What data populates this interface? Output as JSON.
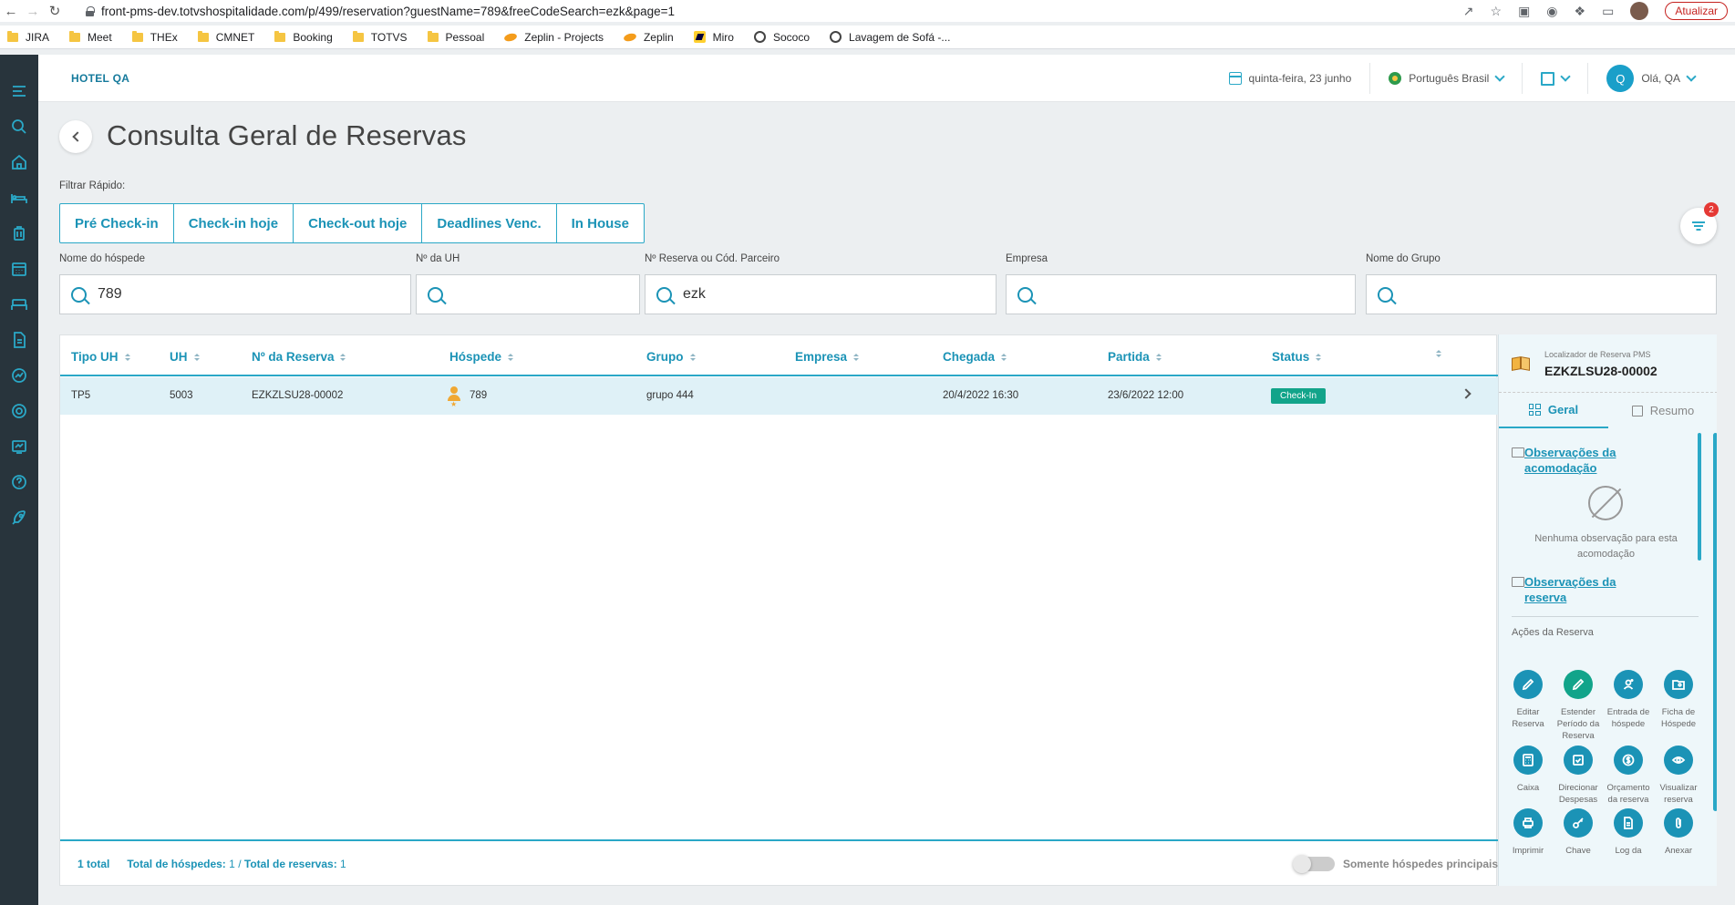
{
  "browser": {
    "url": "front-pms-dev.totvshospitalidade.com/p/499/reservation?guestName=789&freeCodeSearch=ezk&page=1",
    "update_label": "Atualizar",
    "bookmarks": [
      {
        "label": "JIRA",
        "icon": "folder-icon"
      },
      {
        "label": "Meet",
        "icon": "folder-icon"
      },
      {
        "label": "THEx",
        "icon": "folder-icon"
      },
      {
        "label": "CMNET",
        "icon": "folder-icon"
      },
      {
        "label": "Booking",
        "icon": "folder-icon"
      },
      {
        "label": "TOTVS",
        "icon": "folder-icon"
      },
      {
        "label": "Pessoal",
        "icon": "folder-icon"
      },
      {
        "label": "Zeplin - Projects",
        "icon": "zeplin-icon"
      },
      {
        "label": "Zeplin",
        "icon": "zeplin-icon"
      },
      {
        "label": "Miro",
        "icon": "miro-icon"
      },
      {
        "label": "Sococo",
        "icon": "globe-icon"
      },
      {
        "label": "Lavagem de Sofá -...",
        "icon": "globe-icon"
      }
    ]
  },
  "header": {
    "hotel_name": "HOTEL QA",
    "date": "quinta-feira, 23 junho",
    "language": "Português Brasil",
    "user_initial": "Q",
    "greeting": "Olá, QA"
  },
  "page": {
    "title": "Consulta Geral de Reservas",
    "quick_filter_label": "Filtrar Rápido:",
    "quick_filters": [
      "Pré Check-in",
      "Check-in hoje",
      "Check-out hoje",
      "Deadlines Venc.",
      "In House"
    ],
    "filter_badge_count": "2"
  },
  "search": {
    "guest_name": {
      "label": "Nome do hóspede",
      "value": "789"
    },
    "room_number": {
      "label": "Nº da UH",
      "value": ""
    },
    "reservation_code": {
      "label": "Nº Reserva ou Cód. Parceiro",
      "value": "ezk"
    },
    "company": {
      "label": "Empresa",
      "value": ""
    },
    "group_name": {
      "label": "Nome do Grupo",
      "value": ""
    }
  },
  "table": {
    "columns": [
      "Tipo UH",
      "UH",
      "Nº da Reserva",
      "Hóspede",
      "Grupo",
      "Empresa",
      "Chegada",
      "Partida",
      "Status"
    ],
    "rows": [
      {
        "room_type": "TP5",
        "room": "5003",
        "reservation": "EZKZLSU28-00002",
        "guest": "789",
        "group": "grupo 444",
        "company": "",
        "arrival": "20/4/2022 16:30",
        "departure": "23/6/2022 12:00",
        "status": "Check-In",
        "status_color": "#12a48a"
      }
    ],
    "footer": {
      "total": "1 total",
      "guests_label": "Total de hóspedes:",
      "guests_value": "1",
      "separator": "/",
      "reservations_label": "Total de reservas:",
      "reservations_value": "1",
      "toggle_label": "Somente hóspedes principais"
    }
  },
  "detail": {
    "locator_label": "Localizador de Reserva PMS",
    "locator_code": "EZKZLSU28-00002",
    "tabs": [
      "Geral",
      "Resumo"
    ],
    "room_obs_link": "Observações da acomodação",
    "no_obs_text": "Nenhuma observação para esta acomodação",
    "reservation_obs_link": "Observações da reserva",
    "actions_label": "Ações da Reserva",
    "actions": [
      {
        "label": "Editar Reserva",
        "icon": "pencil-icon"
      },
      {
        "label": "Estender Período da Reserva",
        "icon": "pencil-icon"
      },
      {
        "label": "Entrada de hóspede",
        "icon": "person-add-icon"
      },
      {
        "label": "Ficha de Hóspede",
        "icon": "folder-person-icon"
      },
      {
        "label": "Caixa",
        "icon": "calculator-icon"
      },
      {
        "label": "Direcionar Despesas",
        "icon": "calendar-check-icon"
      },
      {
        "label": "Orçamento da reserva",
        "icon": "dollar-icon"
      },
      {
        "label": "Visualizar reserva",
        "icon": "eye-icon"
      },
      {
        "label": "Imprimir",
        "icon": "printer-icon"
      },
      {
        "label": "Chave",
        "icon": "key-icon"
      },
      {
        "label": "Log da",
        "icon": "document-icon"
      },
      {
        "label": "Anexar",
        "icon": "paperclip-icon"
      }
    ]
  },
  "colors": {
    "accent": "#1b93b6",
    "sidebar": "#28343c",
    "status_checkin": "#12a48a",
    "row_selected": "#dff1f7"
  }
}
